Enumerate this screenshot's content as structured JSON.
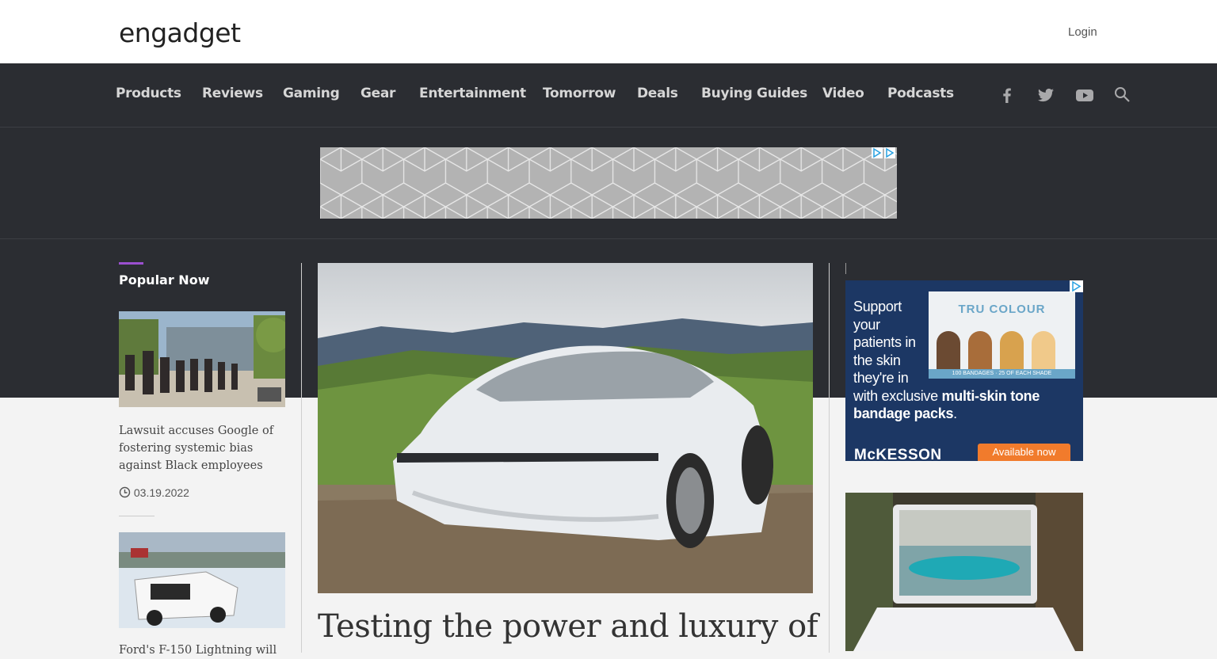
{
  "header": {
    "logo_text": "engadget",
    "login_label": "Login"
  },
  "nav": {
    "items": [
      "Products",
      "Reviews",
      "Gaming",
      "Gear",
      "Entertainment",
      "Tomorrow",
      "Deals",
      "Buying Guides",
      "Video",
      "Podcasts"
    ],
    "social_icons": [
      "facebook-icon",
      "twitter-icon",
      "youtube-icon",
      "search-icon"
    ]
  },
  "sidebar_left": {
    "heading": "Popular Now",
    "stories": [
      {
        "title": "Lawsuit accuses Google of fostering systemic bias against Black employees",
        "date": "03.19.2022"
      },
      {
        "title": "Ford's F-150 Lightning will"
      }
    ]
  },
  "main": {
    "hero_title": "Testing the power and luxury of"
  },
  "side_ad": {
    "line1": "Support your patients in the skin they're in",
    "line2_plain": "with exclusive ",
    "line2_bold": "multi-skin tone bandage packs",
    "line2_end": ".",
    "brand": "McKESSON",
    "cta": "Available now",
    "product_brand": "TRU COLOUR",
    "product_note": "100 BANDAGES · 25 OF EACH SHADE"
  },
  "colors": {
    "dark_bg": "#2b2d32",
    "accent_purple": "#9b4fd0",
    "ad_navy": "#1c3764",
    "cta_orange": "#f17b2c"
  }
}
